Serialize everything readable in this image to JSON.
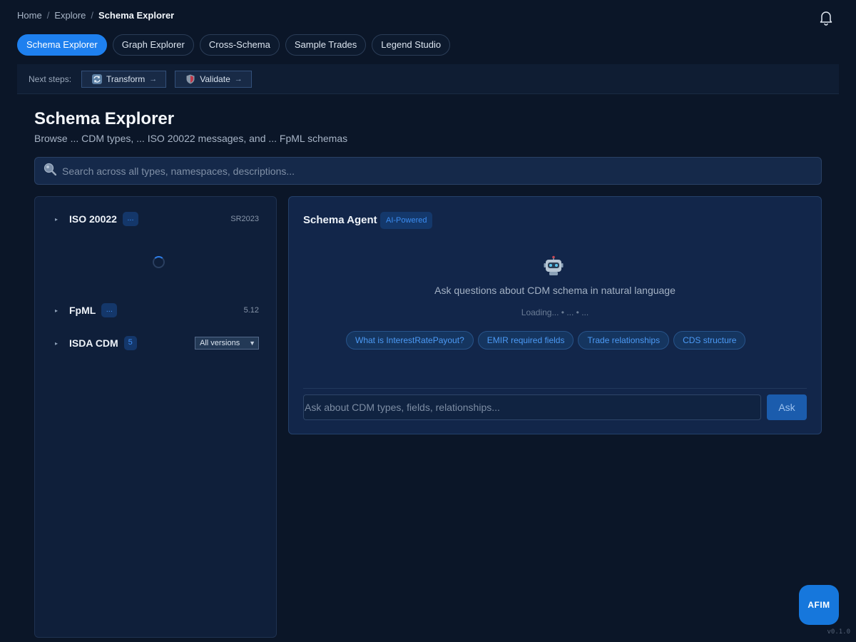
{
  "breadcrumb": {
    "home": "Home",
    "explore": "Explore",
    "current": "Schema Explorer",
    "separator": "/"
  },
  "header": {
    "notifications_icon": "bell-icon"
  },
  "tabs": [
    {
      "label": "Schema Explorer",
      "active": true
    },
    {
      "label": "Graph Explorer",
      "active": false
    },
    {
      "label": "Cross-Schema",
      "active": false
    },
    {
      "label": "Sample Trades",
      "active": false
    },
    {
      "label": "Legend Studio",
      "active": false
    }
  ],
  "next_steps": {
    "label": "Next steps:",
    "transform": {
      "label": "Transform",
      "arrow": "→",
      "icon": "transform-icon"
    },
    "validate": {
      "label": "Validate",
      "arrow": "→",
      "icon": "shield-icon"
    }
  },
  "page": {
    "title": "Schema Explorer",
    "subtitle": "Browse ... CDM types, ... ISO 20022 messages, and ... FpML schemas"
  },
  "search": {
    "placeholder": "Search across all types, namespaces, descriptions...",
    "icon": "search-icon"
  },
  "schemas": {
    "iso": {
      "name": "ISO 20022",
      "count": "...",
      "version": "SR2023",
      "expanded": true,
      "loading": true
    },
    "fpml": {
      "name": "FpML",
      "count": "...",
      "version": "5.12"
    },
    "isda": {
      "name": "ISDA CDM",
      "count": "5",
      "version_select": "All versions"
    },
    "caret": "▸"
  },
  "agent": {
    "title": "Schema Agent",
    "badge": "AI-Powered",
    "icon": "robot-icon",
    "prompt": "Ask questions about CDM schema in natural language",
    "loading": "Loading... • ... • ...",
    "suggestions": [
      "What is InterestRatePayout?",
      "EMIR required fields",
      "Trade relationships",
      "CDS structure"
    ],
    "input_placeholder": "Ask about CDM types, fields, relationships...",
    "ask_label": "Ask"
  },
  "fab": {
    "label": "AFIM"
  },
  "app_version": "v0.1.0",
  "colors": {
    "accent": "#1e80ef",
    "background": "#0b1628",
    "panel": "#0f1f3a",
    "chip_text": "#4c9af5"
  }
}
